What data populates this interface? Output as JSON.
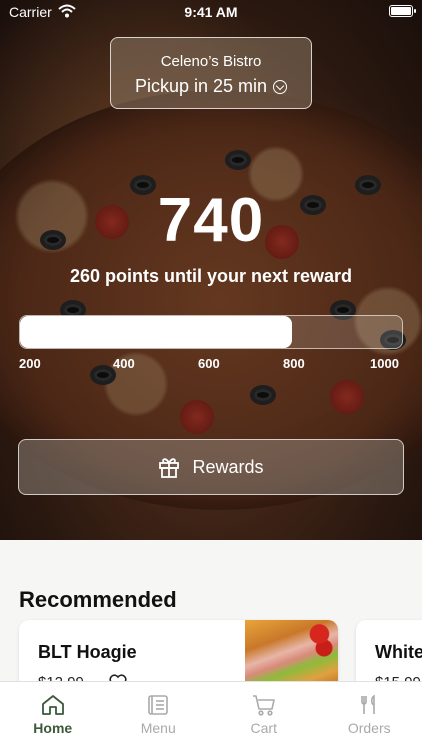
{
  "status_bar": {
    "carrier": "Carrier",
    "time": "9:41 AM"
  },
  "store": {
    "name": "Celeno’s Bistro",
    "pickup": "Pickup in 25 min"
  },
  "loyalty": {
    "points": "740",
    "until_text": "260 points until your next reward",
    "progress_value": 740,
    "progress_min": 100,
    "progress_max": 1000,
    "ticks": [
      "200",
      "400",
      "600",
      "800",
      "1000"
    ]
  },
  "rewards_button": {
    "label": "Rewards",
    "icon": "gift-icon"
  },
  "recommended": {
    "title": "Recommended",
    "items": [
      {
        "name": "BLT Hoagie",
        "price": "$12.99"
      },
      {
        "name": "White",
        "price": "$15.99"
      }
    ]
  },
  "tabbar": {
    "items": [
      {
        "label": "Home",
        "icon": "home-icon",
        "active": true
      },
      {
        "label": "Menu",
        "icon": "menu-icon",
        "active": false
      },
      {
        "label": "Cart",
        "icon": "cart-icon",
        "active": false
      },
      {
        "label": "Orders",
        "icon": "orders-icon",
        "active": false
      }
    ]
  },
  "colors": {
    "accent": "#3b5a3a",
    "inactive": "#aaaaaa"
  }
}
